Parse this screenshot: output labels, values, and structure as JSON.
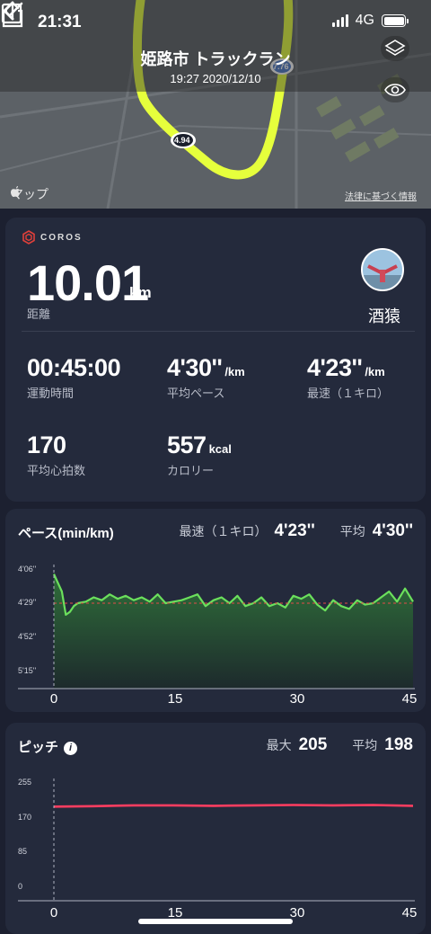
{
  "status": {
    "time": "21:31",
    "network": "4G"
  },
  "header": {
    "title": "姫路市 トラックラン",
    "subtitle": "19:27 2020/12/10"
  },
  "map": {
    "maps_label": "マップ",
    "legal": "法律に基づく情報",
    "marker_a": "4.94",
    "marker_b": "7.76",
    "route_color": "#e6ff3c"
  },
  "brand": "COROS",
  "summary": {
    "distance": {
      "value": "10.01",
      "unit": "km",
      "label": "距離"
    },
    "user": "酒猿",
    "stats": [
      {
        "value": "00:45:00",
        "unit": "",
        "label": "運動時間"
      },
      {
        "value": "4'30''",
        "unit": "/km",
        "label": "平均ペース"
      },
      {
        "value": "4'23''",
        "unit": "/km",
        "label": "最速（１キロ）"
      },
      {
        "value": "170",
        "unit": "",
        "label": "平均心拍数"
      },
      {
        "value": "557",
        "unit": "kcal",
        "label": "カロリー"
      }
    ]
  },
  "pace": {
    "title": "ペース(min/km)",
    "fastest_label": "最速（１キロ）",
    "fastest_value": "4'23''",
    "avg_label": "平均",
    "avg_value": "4'30''",
    "y_ticks": [
      "4'06''",
      "4'29''",
      "4'52''",
      "5'15''"
    ],
    "x_ticks": [
      "0",
      "15",
      "30",
      "45"
    ],
    "line_color": "#6be05c"
  },
  "cadence": {
    "title": "ピッチ",
    "max_label": "最大",
    "max_value": "205",
    "avg_label": "平均",
    "avg_value": "198",
    "y_ticks": [
      "255",
      "170",
      "85",
      "0"
    ],
    "x_ticks": [
      "0",
      "15",
      "30",
      "45"
    ],
    "line_color": "#ff3d60"
  },
  "chart_data": [
    {
      "type": "area",
      "title": "ペース(min/km)",
      "xlabel": "",
      "ylabel": "",
      "x_range": [
        0,
        45
      ],
      "y_range_sec_per_km": [
        246,
        315
      ],
      "y_inverted": true,
      "avg_line_sec_per_km": 270,
      "x": [
        0,
        0.5,
        1,
        1.5,
        2,
        2.5,
        3,
        4,
        5,
        6,
        7,
        8,
        9,
        10,
        11,
        12,
        13,
        14,
        15,
        16,
        17,
        18,
        19,
        20,
        21,
        22,
        23,
        24,
        25,
        26,
        27,
        28,
        29,
        30,
        31,
        32,
        33,
        34,
        35,
        36,
        37,
        38,
        39,
        40,
        41,
        42,
        43,
        44,
        45
      ],
      "values": [
        250,
        256,
        262,
        278,
        276,
        272,
        270,
        269,
        266,
        268,
        264,
        267,
        265,
        268,
        266,
        269,
        264,
        270,
        269,
        268,
        266,
        264,
        272,
        268,
        266,
        270,
        265,
        272,
        270,
        266,
        272,
        270,
        273,
        265,
        267,
        264,
        271,
        275,
        268,
        272,
        274,
        268,
        271,
        270,
        266,
        262,
        269,
        260,
        269
      ]
    },
    {
      "type": "line",
      "title": "ピッチ",
      "xlabel": "",
      "ylabel": "",
      "x_range": [
        0,
        45
      ],
      "ylim": [
        0,
        255
      ],
      "x": [
        0,
        5,
        10,
        15,
        20,
        25,
        30,
        35,
        40,
        45
      ],
      "values": [
        195,
        196,
        198,
        198,
        197,
        198,
        199,
        198,
        199,
        197
      ]
    }
  ]
}
